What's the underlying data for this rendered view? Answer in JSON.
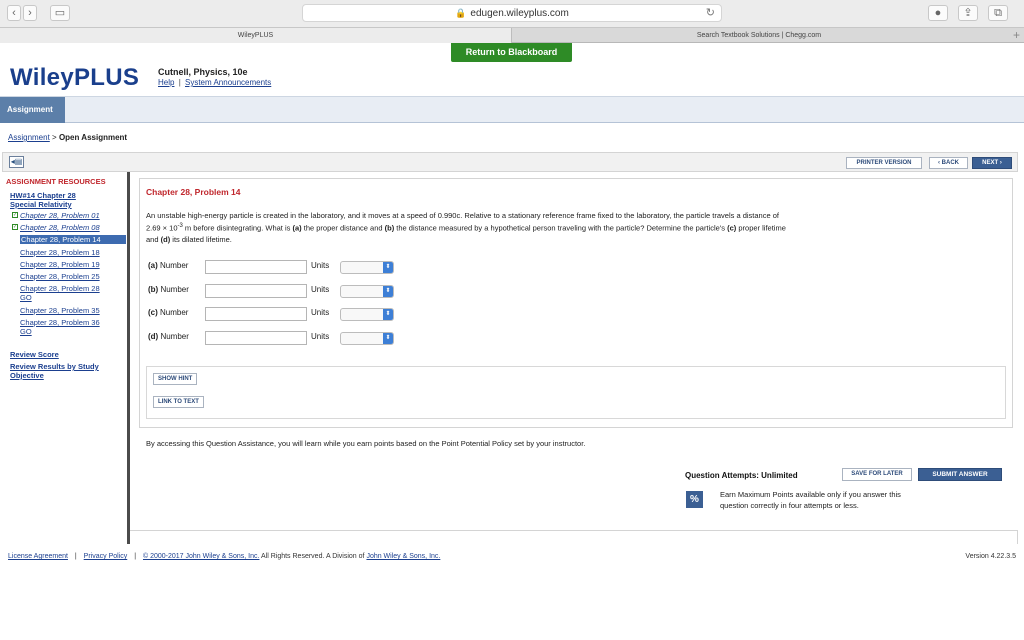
{
  "browser": {
    "url": "edugen.wileyplus.com",
    "tabs": [
      "WileyPLUS",
      "Search Textbook Solutions | Chegg.com"
    ]
  },
  "header": {
    "return_button": "Return to Blackboard",
    "logo": "WileyPLUS",
    "course": "Cutnell, Physics, 10e",
    "help_link": "Help",
    "sep": "|",
    "announcements_link": "System Announcements"
  },
  "nav": {
    "active_tab": "Assignment"
  },
  "breadcrumb": {
    "parent": "Assignment",
    "sep": ">",
    "current": "Open Assignment"
  },
  "frame_buttons": {
    "printer": "PRINTER VERSION",
    "back": "‹ BACK",
    "next": "NEXT ›"
  },
  "sidebar": {
    "heading": "ASSIGNMENT RESOURCES",
    "hw_title_1": "HW#14 Chapter 28",
    "hw_title_2": "Special Relativity",
    "items": [
      "Chapter 28, Problem 01",
      "Chapter 28, Problem 08",
      "Chapter 28, Problem 14",
      "Chapter 28, Problem 18",
      "Chapter 28, Problem 19",
      "Chapter 28, Problem 25",
      "Chapter 28, Problem 28",
      "GO",
      "Chapter 28, Problem 35",
      "Chapter 28, Problem 36",
      "GO"
    ],
    "review_score": "Review Score",
    "review_results_1": "Review Results by Study",
    "review_results_2": "Objective"
  },
  "problem": {
    "title": "Chapter 28, Problem 14",
    "text_1": "An unstable high-energy particle is created in the laboratory, and it moves at a speed of 0.990c. Relative to a stationary reference frame fixed to the laboratory, the particle travels a distance of",
    "text_2a": "2.69 × 10",
    "text_2_exp": "-3",
    "text_2b": " m before disintegrating. What is ",
    "text_2c": "(a)",
    "text_2d": " the proper distance and ",
    "text_2e": "(b)",
    "text_2f": " the distance measured by a hypothetical person traveling with the particle? Determine the particle's ",
    "text_2g": "(c)",
    "text_2h": " proper lifetime",
    "text_3a": "and ",
    "text_3b": "(d)",
    "text_3c": " its dilated lifetime.",
    "answers": [
      {
        "part": "(a)",
        "label": "Number",
        "value": "",
        "units_label": "Units"
      },
      {
        "part": "(b)",
        "label": "Number",
        "value": "",
        "units_label": "Units"
      },
      {
        "part": "(c)",
        "label": "Number",
        "value": "",
        "units_label": "Units"
      },
      {
        "part": "(d)",
        "label": "Number",
        "value": "",
        "units_label": "Units"
      }
    ],
    "show_hint": "SHOW HINT",
    "link_to_text": "LINK TO TEXT"
  },
  "assistance_text": "By accessing this Question Assistance, you will learn while you earn points based on the Point Potential Policy set by your instructor.",
  "attempts": "Question Attempts: Unlimited",
  "save_later": "SAVE FOR LATER",
  "submit": "SUBMIT ANSWER",
  "earn_text": "Earn Maximum Points available only if you answer this question correctly in four attempts or less.",
  "footer": {
    "license": "License Agreement",
    "sep": "|",
    "privacy": "Privacy Policy",
    "copyright_link": "© 2000-2017 John Wiley & Sons, Inc.",
    "copyright_text": " All Rights Reserved. A Division of ",
    "division_link": "John Wiley & Sons, Inc.",
    "version": "Version 4.22.3.5"
  }
}
